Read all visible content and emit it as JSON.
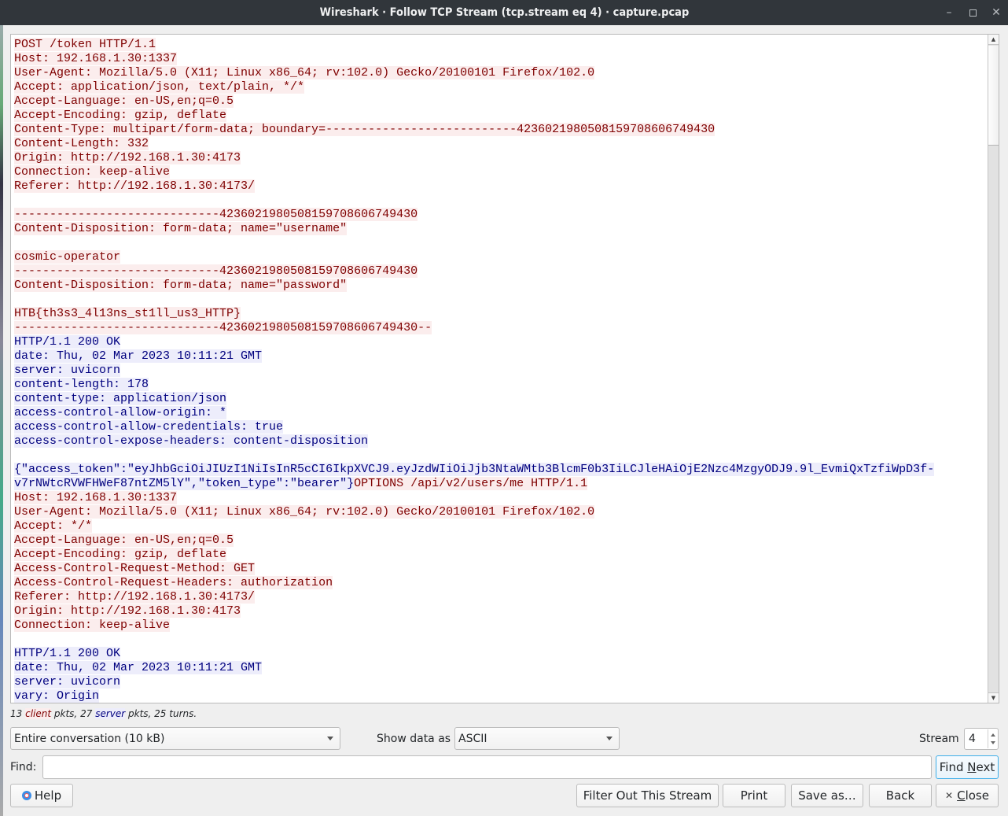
{
  "window": {
    "title": "Wireshark · Follow TCP Stream (tcp.stream eq 4) · capture.pcap",
    "controls": {
      "minimize_icon": "minimize-icon",
      "maximize_icon": "maximize-icon",
      "close_icon": "close-icon"
    }
  },
  "stream": {
    "lines": [
      {
        "dir": "client",
        "text": "POST /token HTTP/1.1"
      },
      {
        "dir": "client",
        "text": "Host: 192.168.1.30:1337"
      },
      {
        "dir": "client",
        "text": "User-Agent: Mozilla/5.0 (X11; Linux x86_64; rv:102.0) Gecko/20100101 Firefox/102.0"
      },
      {
        "dir": "client",
        "text": "Accept: application/json, text/plain, */*"
      },
      {
        "dir": "client",
        "text": "Accept-Language: en-US,en;q=0.5"
      },
      {
        "dir": "client",
        "text": "Accept-Encoding: gzip, deflate"
      },
      {
        "dir": "client",
        "text": "Content-Type: multipart/form-data; boundary=---------------------------42360219805081597086067494 30"
      },
      {
        "dir": "client",
        "text": "Content-Length: 332"
      },
      {
        "dir": "client",
        "text": "Origin: http://192.168.1.30:4173"
      },
      {
        "dir": "client",
        "text": "Connection: keep-alive"
      },
      {
        "dir": "client",
        "text": "Referer: http://192.168.1.30:4173/"
      },
      {
        "dir": "client",
        "text": ""
      },
      {
        "dir": "client",
        "text": "-----------------------------4236021980508159708606749430"
      },
      {
        "dir": "client",
        "text": "Content-Disposition: form-data; name=\"username\""
      },
      {
        "dir": "client",
        "text": ""
      },
      {
        "dir": "client",
        "text": "cosmic-operator"
      },
      {
        "dir": "client",
        "text": "-----------------------------4236021980508159708606749430"
      },
      {
        "dir": "client",
        "text": "Content-Disposition: form-data; name=\"password\""
      },
      {
        "dir": "client",
        "text": ""
      },
      {
        "dir": "client",
        "text": "HTB{th3s3_4l13ns_st1ll_us3_HTTP}"
      },
      {
        "dir": "client",
        "text": "-----------------------------4236021980508159708606749430--"
      },
      {
        "dir": "server",
        "text": "HTTP/1.1 200 OK"
      },
      {
        "dir": "server",
        "text": "date: Thu, 02 Mar 2023 10:11:21 GMT"
      },
      {
        "dir": "server",
        "text": "server: uvicorn"
      },
      {
        "dir": "server",
        "text": "content-length: 178"
      },
      {
        "dir": "server",
        "text": "content-type: application/json"
      },
      {
        "dir": "server",
        "text": "access-control-allow-origin: *"
      },
      {
        "dir": "server",
        "text": "access-control-allow-credentials: true"
      },
      {
        "dir": "server",
        "text": "access-control-expose-headers: content-disposition"
      },
      {
        "dir": "server",
        "text": ""
      },
      {
        "dir": "server",
        "text": "{\"access_token\":\"eyJhbGciOiJIUzI1NiIsInR5cCI6IkpXVCJ9.eyJzdWIiOiJjb3NtaWMtb3BlcmF0b3IiLCJleHAiOjE2Nzc4MzgyODJ9.9l_EvmiQxTzfiWpD3f-"
      },
      {
        "dir": "mixed",
        "parts": [
          {
            "dir": "server",
            "text": "v7rNWtcRVWFHWeF87ntZM5lY\",\"token_type\":\"bearer\"}"
          },
          {
            "dir": "client",
            "text": "OPTIONS /api/v2/users/me HTTP/1.1"
          }
        ]
      },
      {
        "dir": "client",
        "text": "Host: 192.168.1.30:1337"
      },
      {
        "dir": "client",
        "text": "User-Agent: Mozilla/5.0 (X11; Linux x86_64; rv:102.0) Gecko/20100101 Firefox/102.0"
      },
      {
        "dir": "client",
        "text": "Accept: */*"
      },
      {
        "dir": "client",
        "text": "Accept-Language: en-US,en;q=0.5"
      },
      {
        "dir": "client",
        "text": "Accept-Encoding: gzip, deflate"
      },
      {
        "dir": "client",
        "text": "Access-Control-Request-Method: GET"
      },
      {
        "dir": "client",
        "text": "Access-Control-Request-Headers: authorization"
      },
      {
        "dir": "client",
        "text": "Referer: http://192.168.1.30:4173/"
      },
      {
        "dir": "client",
        "text": "Origin: http://192.168.1.30:4173"
      },
      {
        "dir": "client",
        "text": "Connection: keep-alive"
      },
      {
        "dir": "client",
        "text": ""
      },
      {
        "dir": "server",
        "text": "HTTP/1.1 200 OK"
      },
      {
        "dir": "server",
        "text": "date: Thu, 02 Mar 2023 10:11:21 GMT"
      },
      {
        "dir": "server",
        "text": "server: uvicorn"
      },
      {
        "dir": "server",
        "text": "vary: Origin"
      }
    ],
    "colors": {
      "client_fg": "#7f0000",
      "client_bg": "#fbeded",
      "server_fg": "#00007f",
      "server_bg": "#ededfb"
    }
  },
  "stats": {
    "client_count": "13",
    "client_word": "client",
    "server_count": "27",
    "server_word": "server",
    "pkts_word": "pkts,",
    "turns_text": "pkts, 25 turns."
  },
  "controls": {
    "conversation_select": "Entire conversation (10 kB)",
    "show_data_label": "Show data as",
    "show_data_select": "ASCII",
    "stream_label": "Stream",
    "stream_value": "4",
    "find_label": "Find:",
    "find_value": "",
    "find_next_pre": "Find ",
    "find_next_mnemonic": "N",
    "find_next_post": "ext"
  },
  "buttons": {
    "help": "Help",
    "filter_out": "Filter Out This Stream",
    "print": "Print",
    "save_as": "Save as…",
    "back": "Back",
    "close_mnemonic": "C",
    "close_rest": "lose"
  }
}
